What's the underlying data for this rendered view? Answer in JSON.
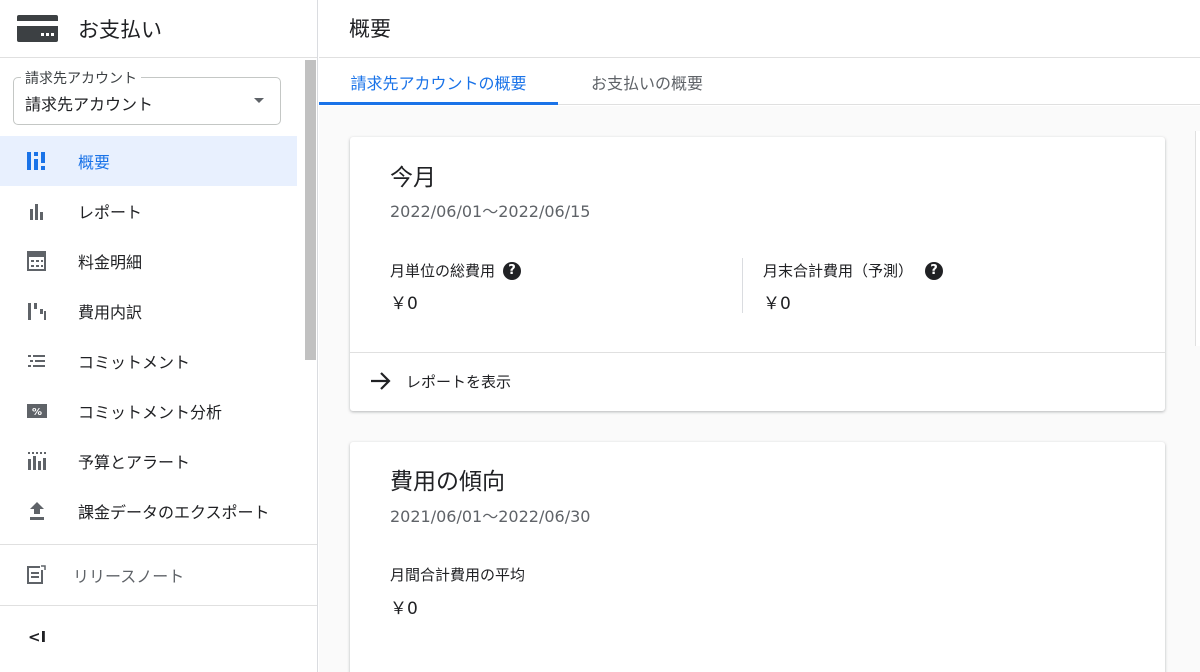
{
  "app": {
    "title": "お支払い",
    "icon": "credit-card-icon"
  },
  "account_selector": {
    "label": "請求先アカウント",
    "value": "請求先アカウント"
  },
  "sidebar": {
    "items": [
      {
        "label": "概要",
        "icon": "dashboard-icon",
        "active": true
      },
      {
        "label": "レポート",
        "icon": "bar-chart-icon",
        "active": false
      },
      {
        "label": "料金明細",
        "icon": "calculator-icon",
        "active": false
      },
      {
        "label": "費用内訳",
        "icon": "waterfall-chart-icon",
        "active": false
      },
      {
        "label": "コミットメント",
        "icon": "list-icon",
        "active": false
      },
      {
        "label": "コミットメント分析",
        "icon": "percent-icon",
        "active": false
      },
      {
        "label": "予算とアラート",
        "icon": "budget-chart-icon",
        "active": false
      },
      {
        "label": "課金データのエクスポート",
        "icon": "upload-icon",
        "active": false
      }
    ],
    "release_notes": "リリースノート",
    "collapse_label": "<I"
  },
  "main": {
    "title": "概要",
    "tabs": [
      {
        "label": "請求先アカウントの概要",
        "active": true
      },
      {
        "label": "お支払いの概要",
        "active": false
      }
    ]
  },
  "cards": {
    "this_month": {
      "title": "今月",
      "date_range": "2022/06/01〜2022/06/15",
      "metric1_label": "月単位の総費用",
      "metric1_value": "￥0",
      "metric2_label": "月末合計費用（予測）",
      "metric2_value": "￥0",
      "link_label": "レポートを表示"
    },
    "trend": {
      "title": "費用の傾向",
      "date_range": "2021/06/01〜2022/06/30",
      "metric_label": "月間合計費用の平均",
      "metric_value": "￥0"
    }
  },
  "colors": {
    "accent": "#1a73e8",
    "active_bg": "#e8f0fe",
    "text": "#202124",
    "secondary": "#5f6368"
  }
}
